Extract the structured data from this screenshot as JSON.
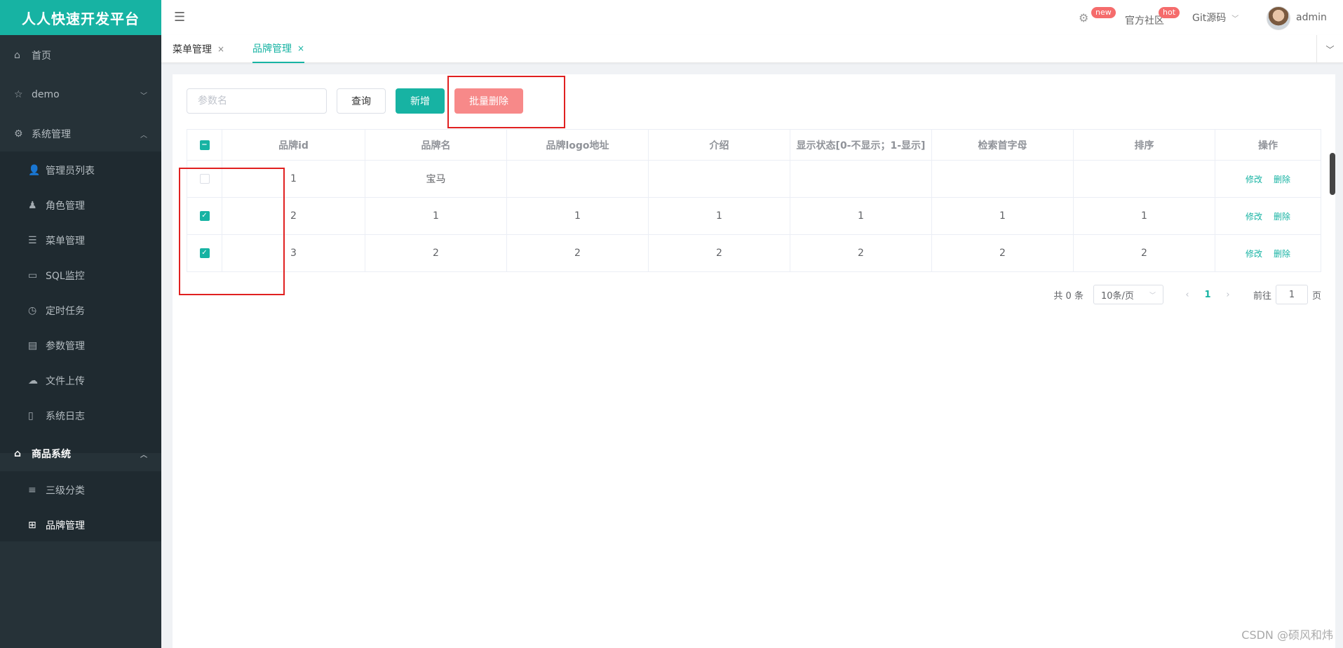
{
  "app": {
    "title": "人人快速开发平台"
  },
  "header": {
    "settings_badge": "new",
    "community_label": "官方社区",
    "community_badge": "hot",
    "git_label": "Git源码",
    "user_name": "admin"
  },
  "sidebar": {
    "items": [
      {
        "label": "首页"
      },
      {
        "label": "demo"
      },
      {
        "label": "系统管理"
      },
      {
        "label": "管理员列表"
      },
      {
        "label": "角色管理"
      },
      {
        "label": "菜单管理"
      },
      {
        "label": "SQL监控"
      },
      {
        "label": "定时任务"
      },
      {
        "label": "参数管理"
      },
      {
        "label": "文件上传"
      },
      {
        "label": "系统日志"
      },
      {
        "label": "商品系统"
      },
      {
        "label": "三级分类"
      },
      {
        "label": "品牌管理"
      }
    ]
  },
  "tabs": [
    {
      "label": "菜单管理",
      "close": "×"
    },
    {
      "label": "品牌管理",
      "close": "×"
    }
  ],
  "toolbar": {
    "search_placeholder": "参数名",
    "query_label": "查询",
    "add_label": "新增",
    "batch_delete_label": "批量删除"
  },
  "table": {
    "columns": [
      "品牌id",
      "品牌名",
      "品牌logo地址",
      "介绍",
      "显示状态[0-不显示；1-显示]",
      "检索首字母",
      "排序",
      "操作"
    ],
    "rows": [
      {
        "checked": false,
        "cells": [
          "1",
          "宝马",
          "",
          "",
          "",
          "",
          ""
        ]
      },
      {
        "checked": true,
        "cells": [
          "2",
          "1",
          "1",
          "1",
          "1",
          "1",
          "1"
        ]
      },
      {
        "checked": true,
        "cells": [
          "3",
          "2",
          "2",
          "2",
          "2",
          "2",
          "2"
        ]
      }
    ],
    "edit_label": "修改",
    "delete_label": "删除"
  },
  "pagination": {
    "total_text": "共 0 条",
    "page_size": "10条/页",
    "current_page": "1",
    "goto_prefix": "前往",
    "goto_value": "1",
    "goto_suffix": "页"
  },
  "watermark": "CSDN @硕风和炜"
}
